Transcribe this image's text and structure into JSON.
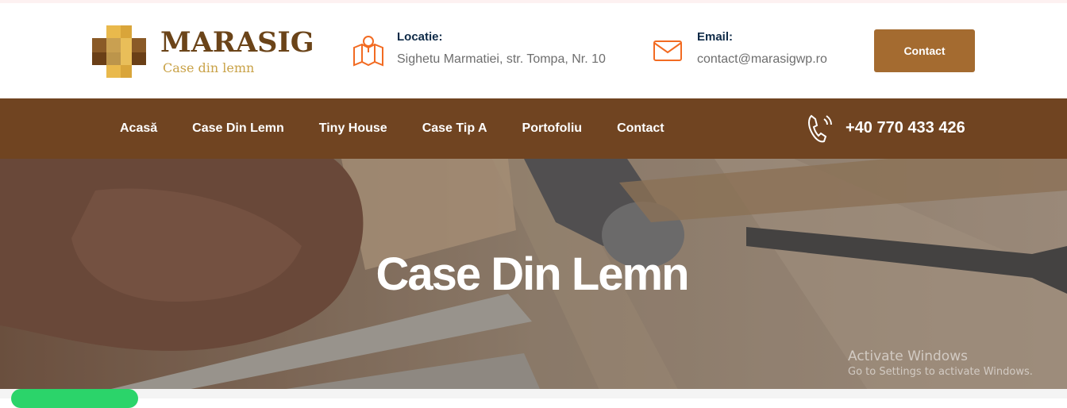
{
  "brand": {
    "name": "MARASIG",
    "tagline": "Case din lemn"
  },
  "header": {
    "location": {
      "title": "Locatie:",
      "text": "Sighetu Marmatiei, str. Tompa, Nr. 10",
      "icon": "map-pin-icon"
    },
    "email": {
      "title": "Email:",
      "text": "contact@marasigwp.ro",
      "icon": "envelope-icon"
    },
    "contact_button": "Contact"
  },
  "nav": {
    "items": [
      "Acasă",
      "Case Din Lemn",
      "Tiny House",
      "Case Tip A",
      "Portofoliu",
      "Contact"
    ],
    "phone": "+40 770 433 426"
  },
  "hero": {
    "title": "Case Din Lemn"
  },
  "watermark": {
    "line1": "Activate Windows",
    "line2": "Go to Settings to activate Windows."
  },
  "colors": {
    "brand_brown": "#704421",
    "button_brown": "#a46b30",
    "accent_orange": "#f26b22",
    "logo_gold": "#c9a247"
  }
}
